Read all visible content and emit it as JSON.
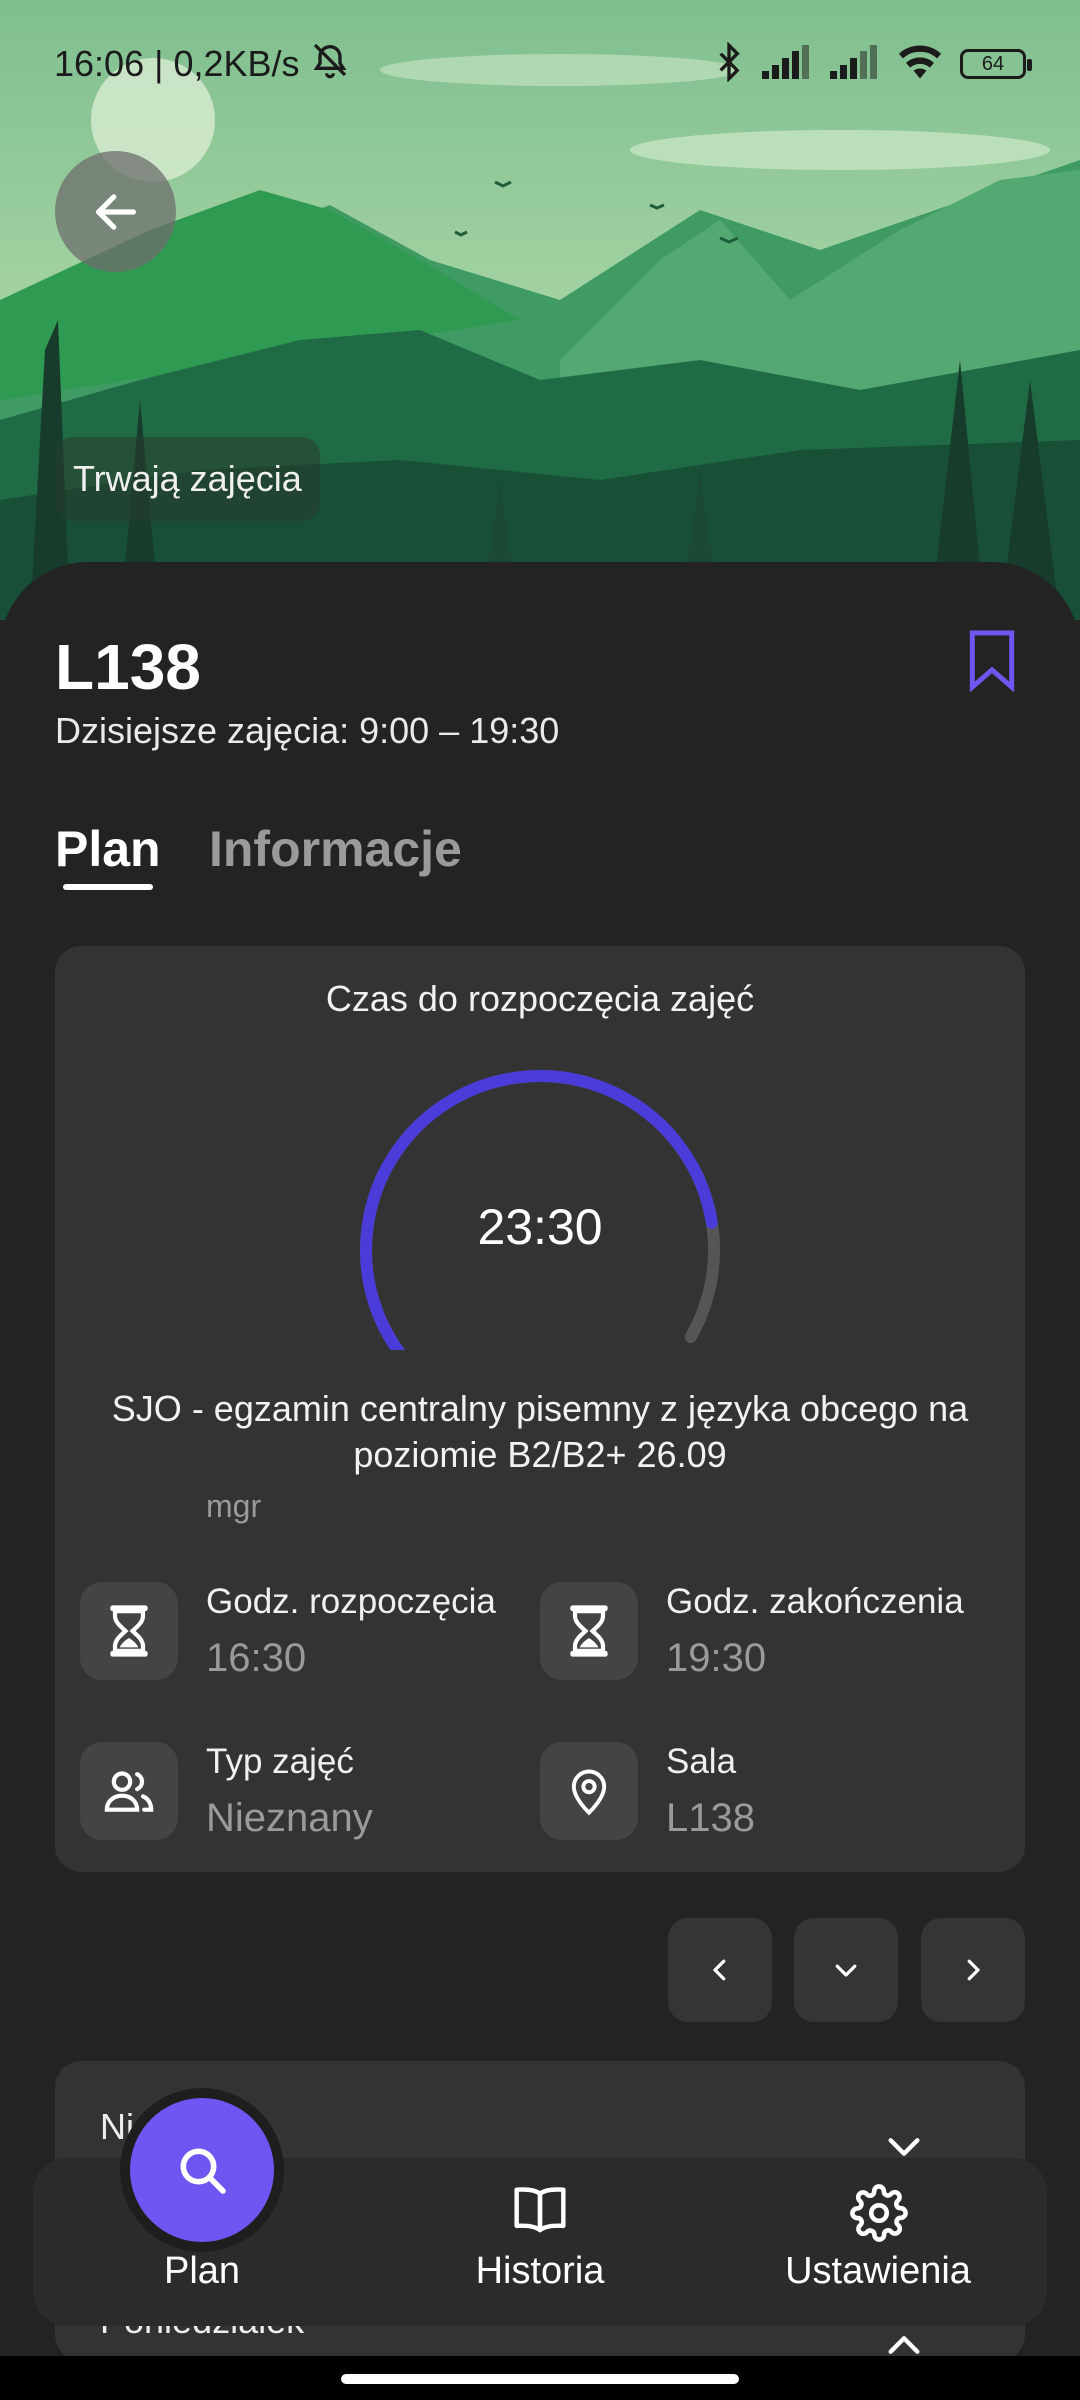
{
  "status_bar": {
    "time_speed": "16:06 | 0,2KB/s",
    "battery": "64"
  },
  "hero": {
    "status_chip": "Trwają zajęcia"
  },
  "room": {
    "title": "L138",
    "today_label": "Dzisiejsze zajęcia: 9:00 – 19:30"
  },
  "tabs": [
    {
      "label": "Plan",
      "active": true
    },
    {
      "label": "Informacje",
      "active": false
    }
  ],
  "card": {
    "heading": "Czas do rozpoczęcia zajęć",
    "countdown": "23:30",
    "progress": 0.85,
    "course_title": "SJO - egzamin centralny pisemny z języka obcego na poziomie B2/B2+ 26.09",
    "teacher": "mgr",
    "start_label": "Godz. rozpoczęcia",
    "start_value": "16:30",
    "end_label": "Godz. zakończenia",
    "end_value": "19:30",
    "type_label": "Typ zajęć",
    "type_value": "Nieznany",
    "room_label": "Sala",
    "room_value": "L138"
  },
  "second_card": {
    "line1": "Ni",
    "line2": "Poniedziałek"
  },
  "bottom_nav": {
    "plan": "Plan",
    "history": "Historia",
    "settings": "Ustawienia"
  },
  "colors": {
    "accent": "#7155f2",
    "gauge_progress": "#4b3bd8",
    "gauge_track": "#555555",
    "card_bg": "#333333",
    "page_bg": "#232323"
  }
}
